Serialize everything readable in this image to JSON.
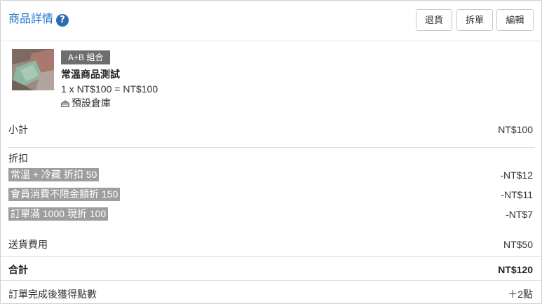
{
  "header": {
    "title": "商品詳情",
    "help_icon": "question-circle-icon",
    "buttons": {
      "return_label": "退貨",
      "split_label": "拆單",
      "edit_label": "編輯"
    }
  },
  "product": {
    "badge": "A+B 組合",
    "name": "常溫商品測試",
    "price_line": "1 x NT$100 = NT$100",
    "warehouse": "預設倉庫",
    "warehouse_icon": "warehouse-icon"
  },
  "summary": {
    "subtotal_label": "小計",
    "subtotal_value": "NT$100",
    "discount_label": "折扣",
    "discounts": [
      {
        "name": "常溫 + 冷藏 折扣 50",
        "amount": "-NT$12"
      },
      {
        "name": "會員消費不限金額折 150",
        "amount": "-NT$11"
      },
      {
        "name": "訂單滿 1000 現折 100",
        "amount": "-NT$7"
      }
    ],
    "shipping_label": "送貨費用",
    "shipping_value": "NT$50",
    "total_label": "合計",
    "total_value": "NT$120",
    "points_label": "訂單完成後獲得點數",
    "points_value": "＋2點"
  },
  "colors": {
    "title": "#1a73c6",
    "help_icon": "#2b6cb5",
    "badge_bg": "#6e6e6e",
    "discount_tag_bg": "#9e9e9e"
  }
}
